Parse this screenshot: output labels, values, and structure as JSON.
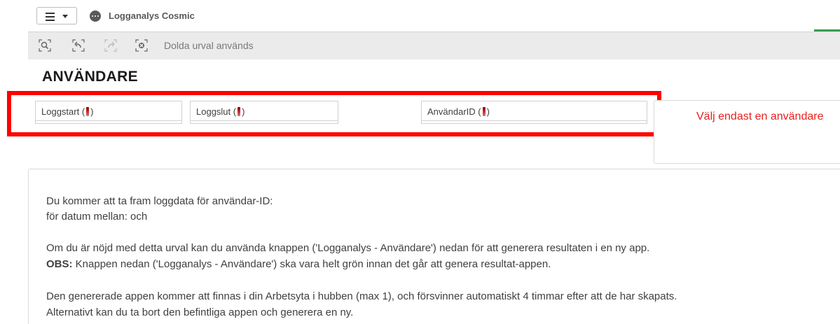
{
  "app": {
    "title": "Logganalys Cosmic"
  },
  "toolbar": {
    "hidden_selections_label": "Dolda urval används",
    "tools": [
      "smart-search-icon",
      "step-back-icon",
      "step-forward-icon",
      "clear-selections-icon"
    ]
  },
  "sheet": {
    "title": "ANVÄNDARE"
  },
  "filters": [
    {
      "label_before": "Loggstart (",
      "label_after": ")"
    },
    {
      "label_before": "Loggslut (",
      "label_after": ")"
    },
    {
      "label_before": "AnvändarID (",
      "label_after": ")"
    }
  ],
  "warning": {
    "text": "Välj endast en användare"
  },
  "info": {
    "line1": "Du kommer att ta fram loggdata för användar-ID:",
    "line2": "för datum mellan: och",
    "line3": "Om du är nöjd med detta urval kan du använda knappen ('Logganalys - Användare') nedan för att generera resultaten i en ny app.",
    "obs_label": "OBS:",
    "line4": " Knappen nedan ('Logganalys - Användare') ska vara helt grön innan det går att genera resultat-appen.",
    "line5": "Den genererade appen kommer att finnas i din Arbetsyta i hubben (max 1), och försvinner automatiskt 4 timmar efter att de har skapats.",
    "line6": "Alternativt kan du ta bort den befintliga appen och generera en ny."
  },
  "colors": {
    "accent_green": "#3a9b4f",
    "warning_red": "#e8211d",
    "highlight_red": "#ff0000"
  }
}
